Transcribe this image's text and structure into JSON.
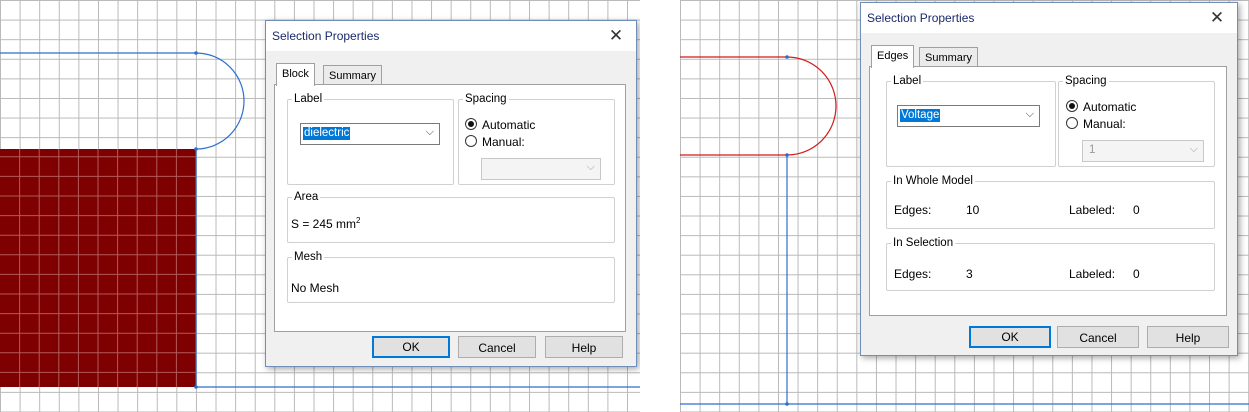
{
  "colors": {
    "block_fill": "#7f0000",
    "edge_blue": "#2c6fcf",
    "edge_red": "#d21b1b",
    "accent": "#0078d7"
  },
  "left": {
    "dialog": {
      "title": "Selection Properties",
      "close_glyph": "✕",
      "tabs": [
        {
          "label": "Block",
          "active": true
        },
        {
          "label": "Summary",
          "active": false
        }
      ],
      "label_group": {
        "legend": "Label",
        "value": "dielectric"
      },
      "spacing_group": {
        "legend": "Spacing",
        "automatic": "Automatic",
        "manual": "Manual:",
        "selected": "automatic",
        "manual_value": ""
      },
      "area_group": {
        "legend": "Area",
        "prefix": "S = 245 mm",
        "superscript": "2"
      },
      "mesh_group": {
        "legend": "Mesh",
        "value": "No Mesh"
      },
      "buttons": {
        "ok": "OK",
        "cancel": "Cancel",
        "help": "Help"
      }
    }
  },
  "right": {
    "dialog": {
      "title": "Selection Properties",
      "close_glyph": "✕",
      "tabs": [
        {
          "label": "Edges",
          "active": true
        },
        {
          "label": "Summary",
          "active": false
        }
      ],
      "label_group": {
        "legend": "Label",
        "value": "Voltage"
      },
      "spacing_group": {
        "legend": "Spacing",
        "automatic": "Automatic",
        "manual": "Manual:",
        "selected": "automatic",
        "manual_value": "1"
      },
      "whole_model": {
        "legend": "In Whole Model",
        "edges_label": "Edges:",
        "edges_value": "10",
        "labeled_label": "Labeled:",
        "labeled_value": "0"
      },
      "selection": {
        "legend": "In Selection",
        "edges_label": "Edges:",
        "edges_value": "3",
        "labeled_label": "Labeled:",
        "labeled_value": "0"
      },
      "buttons": {
        "ok": "OK",
        "cancel": "Cancel",
        "help": "Help"
      }
    }
  }
}
